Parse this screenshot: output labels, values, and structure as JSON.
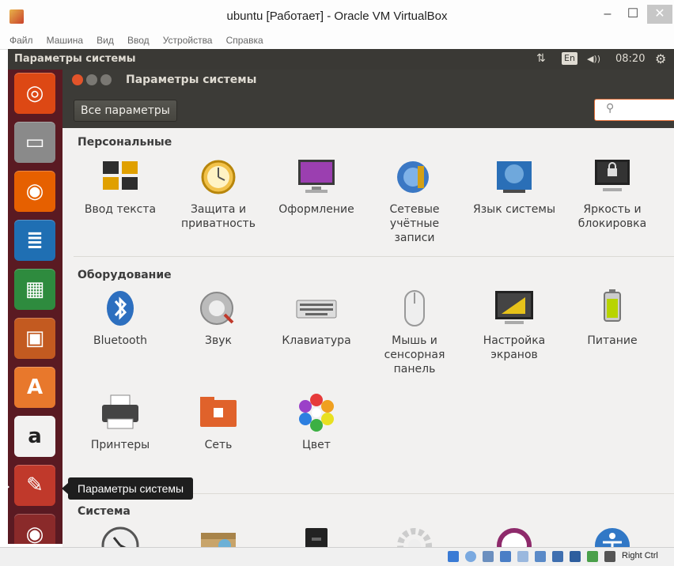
{
  "host": {
    "title": "ubuntu [Работает] - Oracle VM VirtualBox",
    "controls": {
      "minimize": "–",
      "maximize": "☐",
      "close": "✕"
    },
    "menu": [
      "Файл",
      "Машина",
      "Вид",
      "Ввод",
      "Устройства",
      "Справка"
    ]
  },
  "panel": {
    "title": "Параметры системы",
    "network_icon": "⇅",
    "lang": "En",
    "volume_icon": "◀))",
    "time": "08:20",
    "gear_icon": "⚙"
  },
  "launcher": {
    "tooltip": "Параметры системы",
    "items": [
      {
        "name": "ubuntu-dash-icon",
        "color": "#dd4814",
        "glyph": "◎"
      },
      {
        "name": "files-icon",
        "color": "#7a7a7a",
        "glyph": "▭"
      },
      {
        "name": "firefox-icon",
        "color": "#e66000",
        "glyph": "◉"
      },
      {
        "name": "writer-icon",
        "color": "#1f6fb3",
        "glyph": "≣"
      },
      {
        "name": "calc-icon",
        "color": "#2e8b3e",
        "glyph": "▦"
      },
      {
        "name": "impress-icon",
        "color": "#c35a20",
        "glyph": "▣"
      },
      {
        "name": "software-center-icon",
        "color": "#e8782c",
        "glyph": "A"
      },
      {
        "name": "amazon-icon",
        "color": "#f2f1f0",
        "glyph": "a"
      },
      {
        "name": "system-settings-icon",
        "color": "#c0392b",
        "glyph": "✎"
      },
      {
        "name": "dvd-icon",
        "color": "#8a2a2a",
        "glyph": "◉"
      }
    ]
  },
  "app": {
    "title": "Параметры системы",
    "all_settings": "Все параметры",
    "search_icon": "⚲",
    "search_value": "",
    "sections": {
      "personal": {
        "title": "Персональные",
        "items": [
          {
            "label": "Ввод текста",
            "icon": "keyboard-text-entry-icon"
          },
          {
            "label": "Защита и приватность",
            "icon": "privacy-icon"
          },
          {
            "label": "Оформление",
            "icon": "appearance-icon"
          },
          {
            "label": "Сетевые учётные записи",
            "icon": "online-accounts-icon"
          },
          {
            "label": "Язык системы",
            "icon": "language-icon"
          },
          {
            "label": "Яркость и блокировка",
            "icon": "brightness-lock-icon"
          }
        ]
      },
      "hardware": {
        "title": "Оборудование",
        "items": [
          {
            "label": "Bluetooth",
            "icon": "bluetooth-icon"
          },
          {
            "label": "Звук",
            "icon": "sound-icon"
          },
          {
            "label": "Клавиатура",
            "icon": "keyboard-icon"
          },
          {
            "label": "Мышь и сенсорная панель",
            "icon": "mouse-icon"
          },
          {
            "label": "Настройка экранов",
            "icon": "displays-icon"
          },
          {
            "label": "Питание",
            "icon": "power-icon"
          },
          {
            "label": "Принтеры",
            "icon": "printer-icon"
          },
          {
            "label": "Сеть",
            "icon": "network-icon"
          },
          {
            "label": "Цвет",
            "icon": "color-icon"
          }
        ]
      },
      "system": {
        "title": "Система"
      }
    }
  },
  "status": {
    "right_ctrl": "Right Ctrl"
  }
}
